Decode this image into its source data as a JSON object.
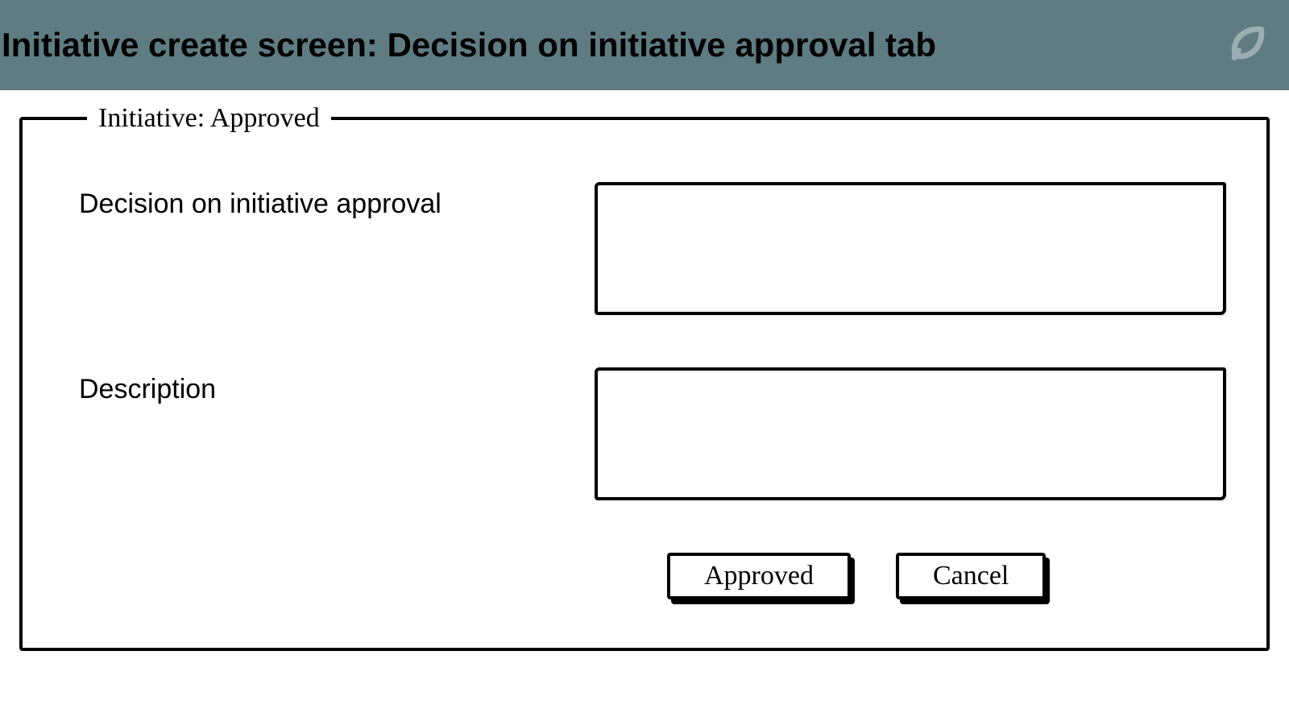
{
  "header": {
    "title": "Initiative create screen: Decision on initiative approval tab"
  },
  "form": {
    "legend": "Initiative: Approved",
    "fields": {
      "decision": {
        "label": "Decision on initiative approval",
        "value": ""
      },
      "description": {
        "label": "Description",
        "value": ""
      }
    },
    "buttons": {
      "approve": "Approved",
      "cancel": "Cancel"
    }
  }
}
